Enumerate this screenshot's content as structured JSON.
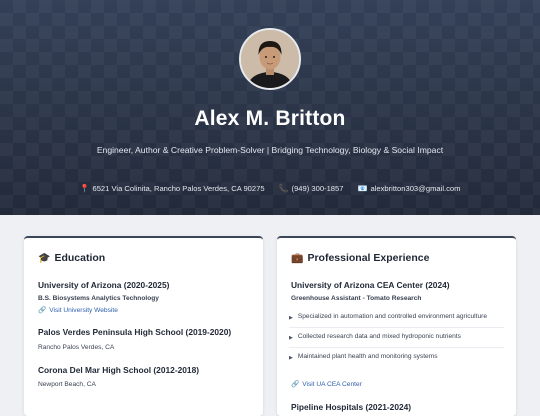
{
  "profile": {
    "name": "Alex M. Britton",
    "tagline": "Engineer, Author & Creative Problem-Solver | Bridging Technology, Biology & Social Impact",
    "address": "6521 Via Colinita, Rancho Palos Verdes, CA 90275",
    "phone": "(949) 300-1857",
    "email": "alexbritton303@gmail.com"
  },
  "icons": {
    "location": "map-pin-icon",
    "phone": "phone-icon",
    "email": "envelope-icon",
    "education": "graduation-cap-icon",
    "experience": "briefcase-icon",
    "link": "link-icon"
  },
  "education": {
    "title": "Education",
    "entries": [
      {
        "school": "University of Arizona (2020-2025)",
        "detail": "B.S. Biosystems Analytics Technology",
        "link": "Visit University Website"
      },
      {
        "school": "Palos Verdes Peninsula High School (2019-2020)",
        "detail": "Rancho Palos Verdes, CA"
      },
      {
        "school": "Corona Del Mar High School (2012-2018)",
        "detail": "Newport Beach, CA"
      }
    ]
  },
  "experience": {
    "title": "Professional Experience",
    "entries": [
      {
        "org": "University of Arizona CEA Center (2024)",
        "role": "Greenhouse Assistant - Tomato Research",
        "bullets": [
          "Specialized in automation and controlled environment agriculture",
          "Collected research data and mixed hydroponic nutrients",
          "Maintained plant health and monitoring systems"
        ],
        "link": "Visit UA CEA Center"
      },
      {
        "org": "Pipeline Hospitals (2021-2024)"
      }
    ]
  },
  "colors": {
    "hero_bg": "#2b3445",
    "card_accent": "#3b4658",
    "link": "#2e5fae"
  }
}
